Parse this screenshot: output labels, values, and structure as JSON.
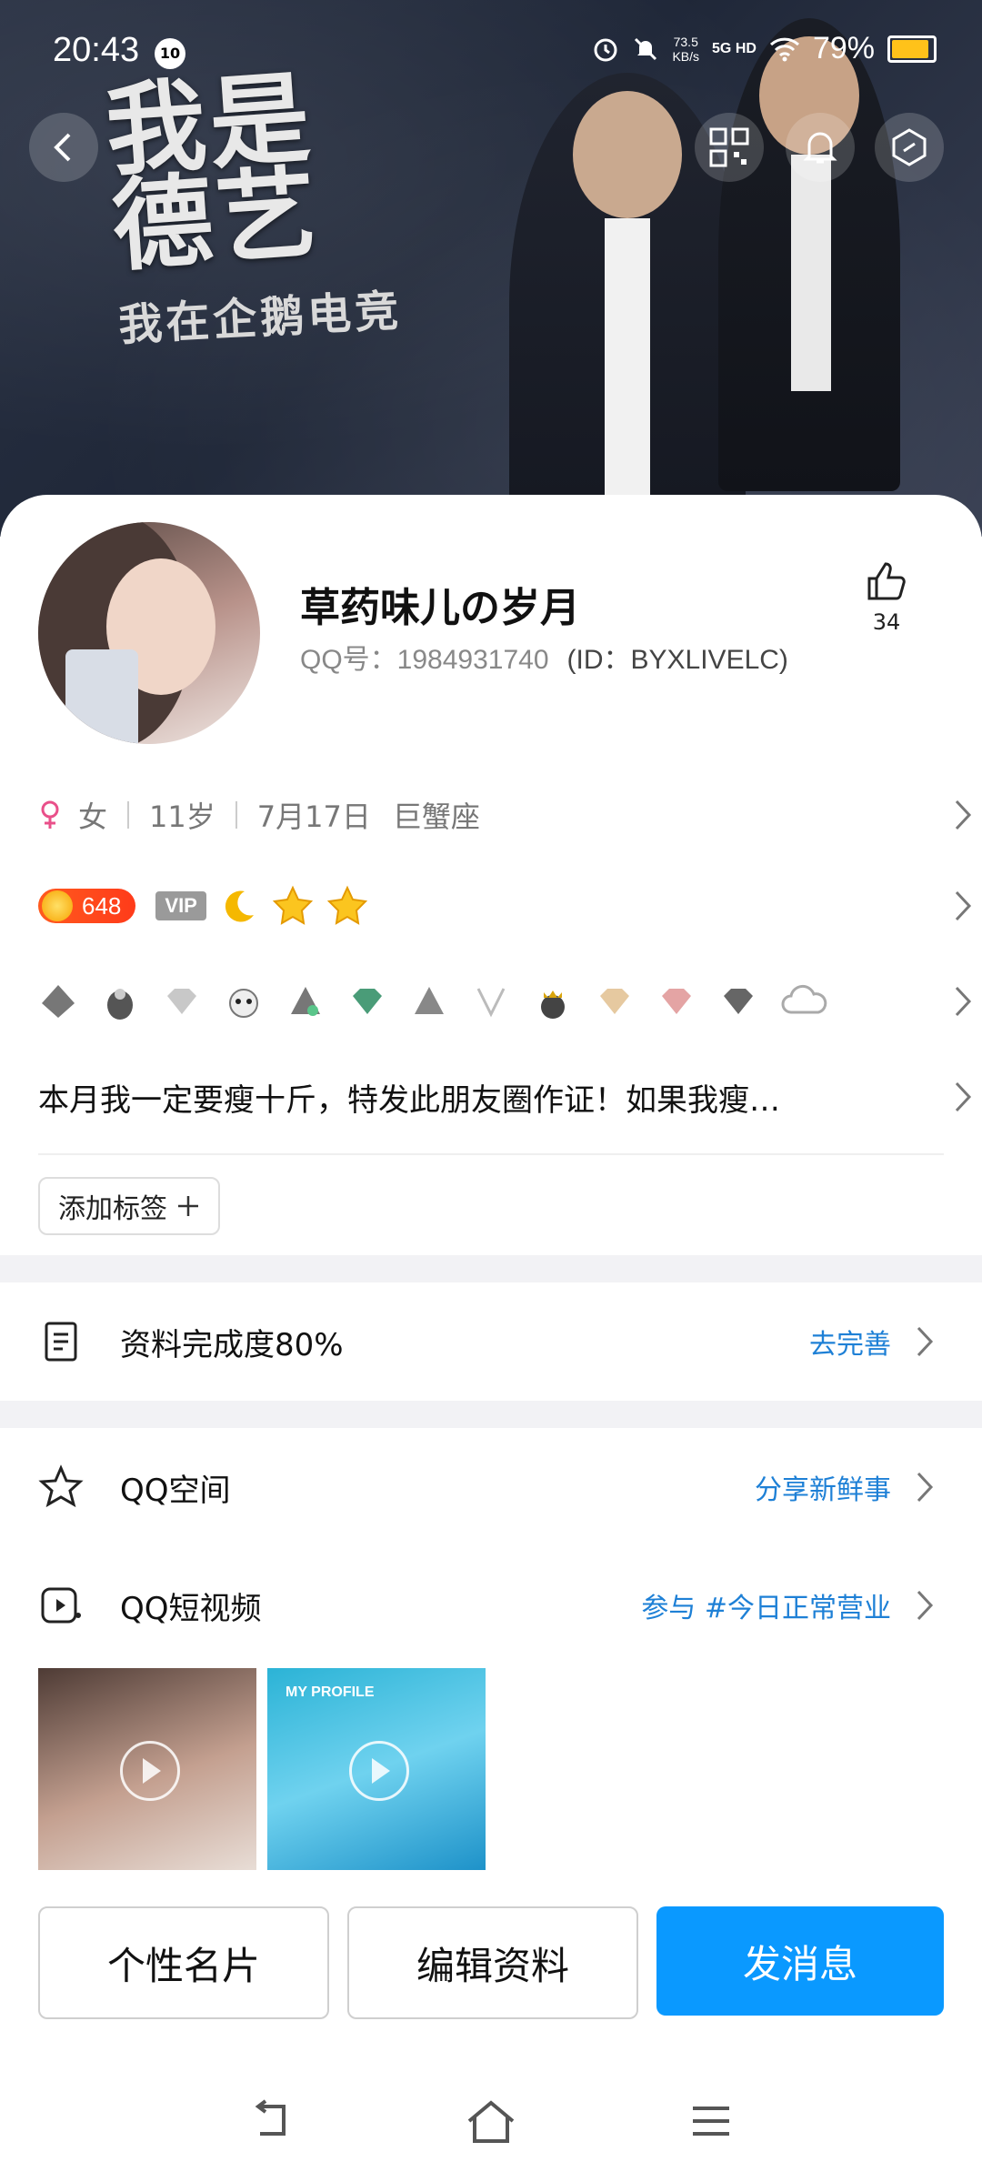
{
  "status_bar": {
    "time": "20:43",
    "notif_badge": "10",
    "net_speed_value": "73.5",
    "net_speed_unit": "KB/s",
    "network": "5G HD",
    "battery": "79%",
    "battery_color": "#ffc21a"
  },
  "banner": {
    "title": "我是德艺",
    "subtitle": "我在企鹅电竞"
  },
  "profile": {
    "nickname": "草药味儿の岁月",
    "qq_number": "QQ号：1984931740",
    "alt_id": "(ID：BYXLIVELC)",
    "likes": "34"
  },
  "info": {
    "gender": "女",
    "age": "11岁",
    "birthday": "7月17日",
    "zodiac": "巨蟹座"
  },
  "badges": {
    "level": "648",
    "vip": "VIP"
  },
  "signature": "本月我一定要瘦十斤，特发此朋友圈作证！如果我瘦…",
  "add_tag": "添加标签",
  "completeness": {
    "label": "资料完成度80%",
    "action": "去完善"
  },
  "qzone": {
    "label": "QQ空间",
    "action": "分享新鲜事"
  },
  "short_video": {
    "label": "QQ短视频",
    "action": "参与 #今日正常营业",
    "thumb2_label": "MY PROFILE"
  },
  "buttons": {
    "card": "个性名片",
    "edit": "编辑资料",
    "message": "发消息"
  },
  "colors": {
    "accent": "#0a99ff",
    "link": "#1e80d6",
    "gender_female": "#e9508a"
  }
}
